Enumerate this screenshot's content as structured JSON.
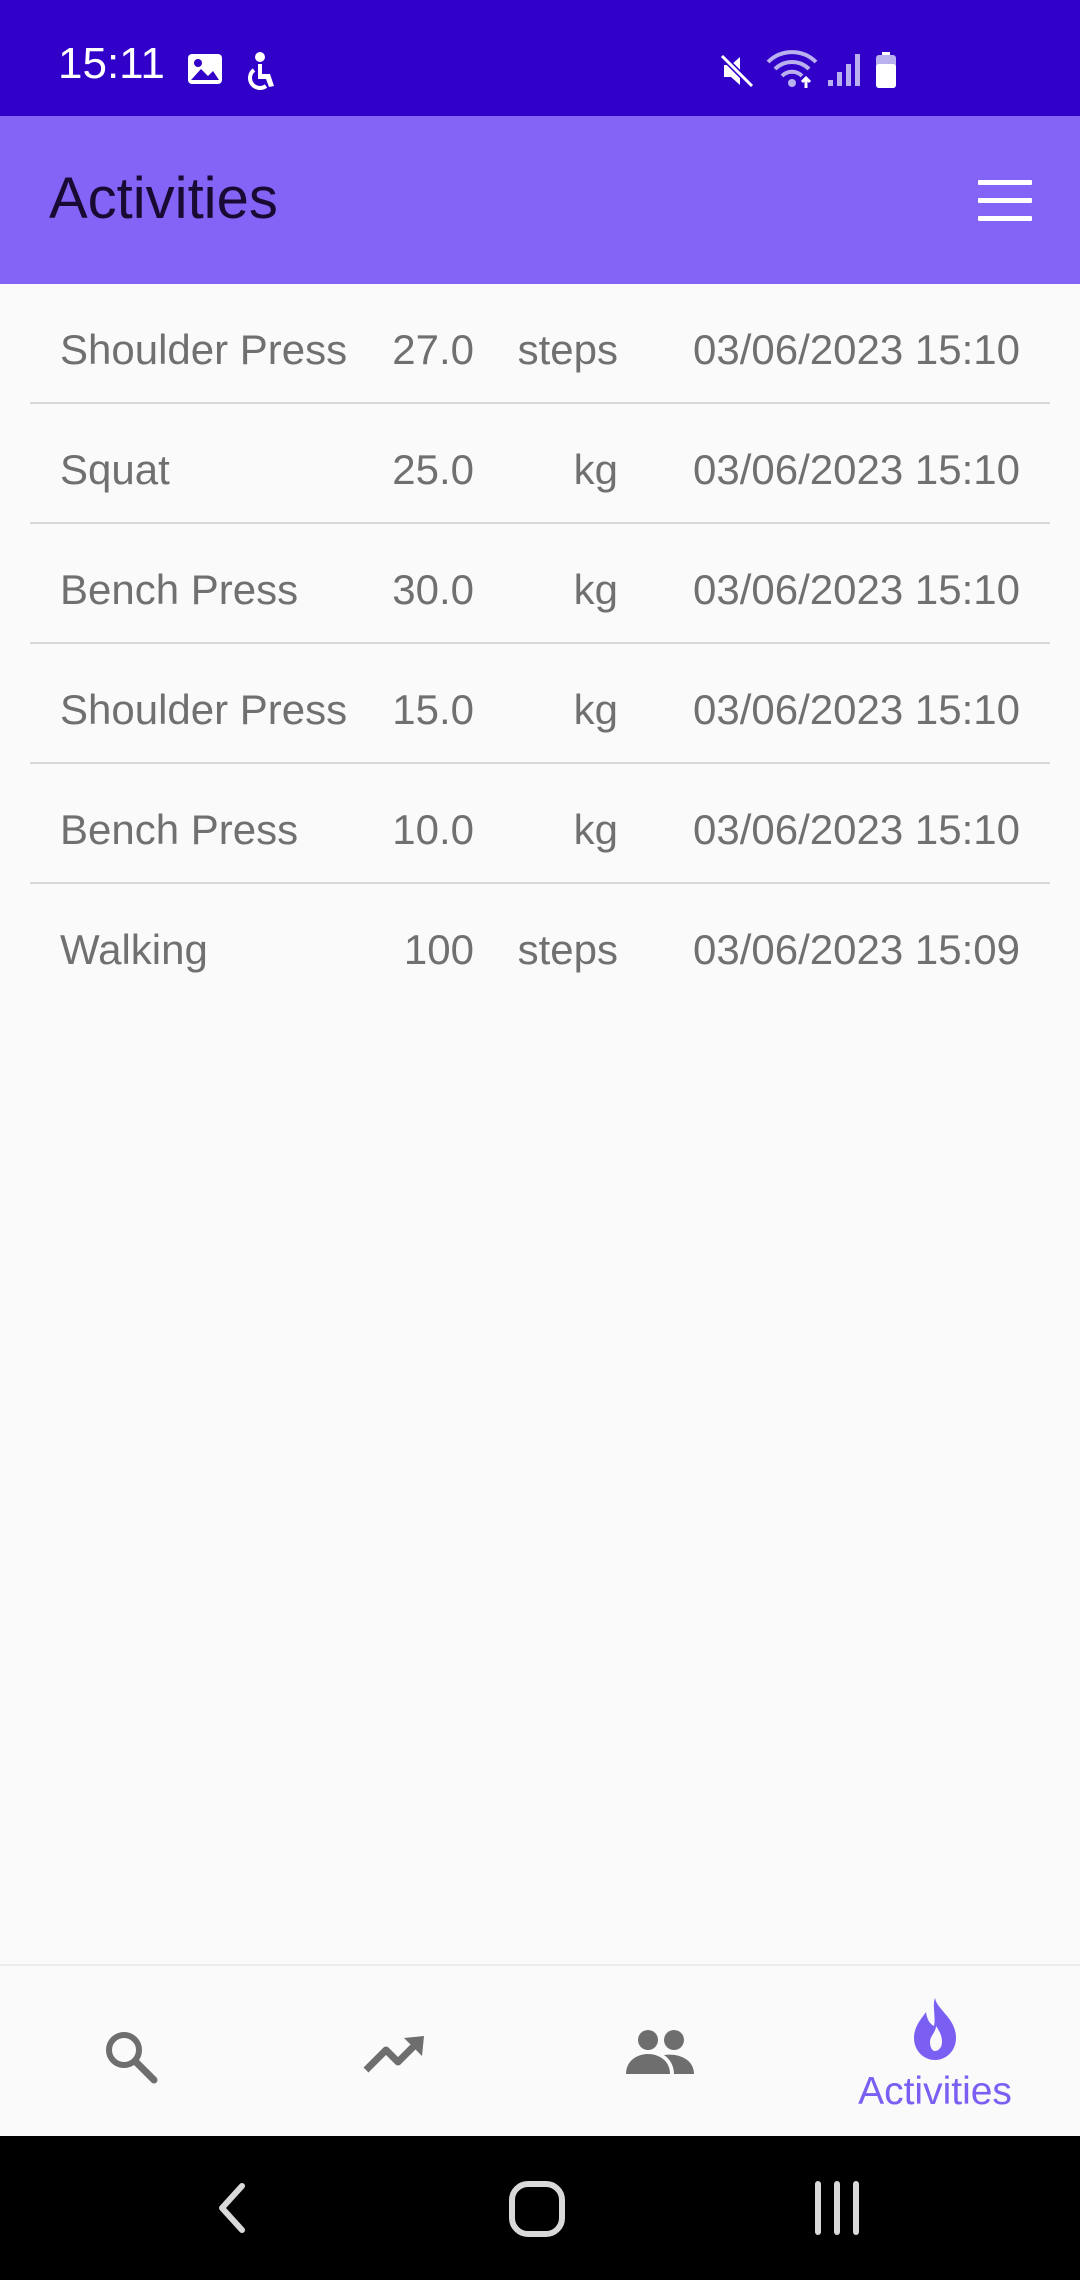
{
  "status_bar": {
    "time": "15:11",
    "icons": [
      "image-icon",
      "accessibility-icon",
      "mute-icon",
      "wifi-icon",
      "signal-icon",
      "battery-icon"
    ]
  },
  "app_bar": {
    "title": "Activities",
    "menu_icon": "hamburger-menu-icon"
  },
  "activities": [
    {
      "name": "Shoulder Press",
      "value": "27.0",
      "unit": "steps",
      "datetime": "03/06/2023 15:10"
    },
    {
      "name": "Squat",
      "value": "25.0",
      "unit": "kg",
      "datetime": "03/06/2023 15:10"
    },
    {
      "name": "Bench Press",
      "value": "30.0",
      "unit": "kg",
      "datetime": "03/06/2023 15:10"
    },
    {
      "name": "Shoulder Press",
      "value": "15.0",
      "unit": "kg",
      "datetime": "03/06/2023 15:10"
    },
    {
      "name": "Bench Press",
      "value": "10.0",
      "unit": "kg",
      "datetime": "03/06/2023 15:10"
    },
    {
      "name": "Walking",
      "value": "100",
      "unit": "steps",
      "datetime": "03/06/2023 15:09"
    }
  ],
  "bottom_nav": {
    "items": [
      {
        "icon": "search-icon",
        "label": "",
        "selected": false
      },
      {
        "icon": "trending-up-icon",
        "label": "",
        "selected": false
      },
      {
        "icon": "people-icon",
        "label": "",
        "selected": false
      },
      {
        "icon": "flame-icon",
        "label": "Activities",
        "selected": true
      }
    ]
  },
  "colors": {
    "status_bar": "#3100c9",
    "app_bar": "#8364f6",
    "accent": "#7b5ef2",
    "text_secondary": "#707070",
    "icon_inactive": "#6e6e6e"
  }
}
